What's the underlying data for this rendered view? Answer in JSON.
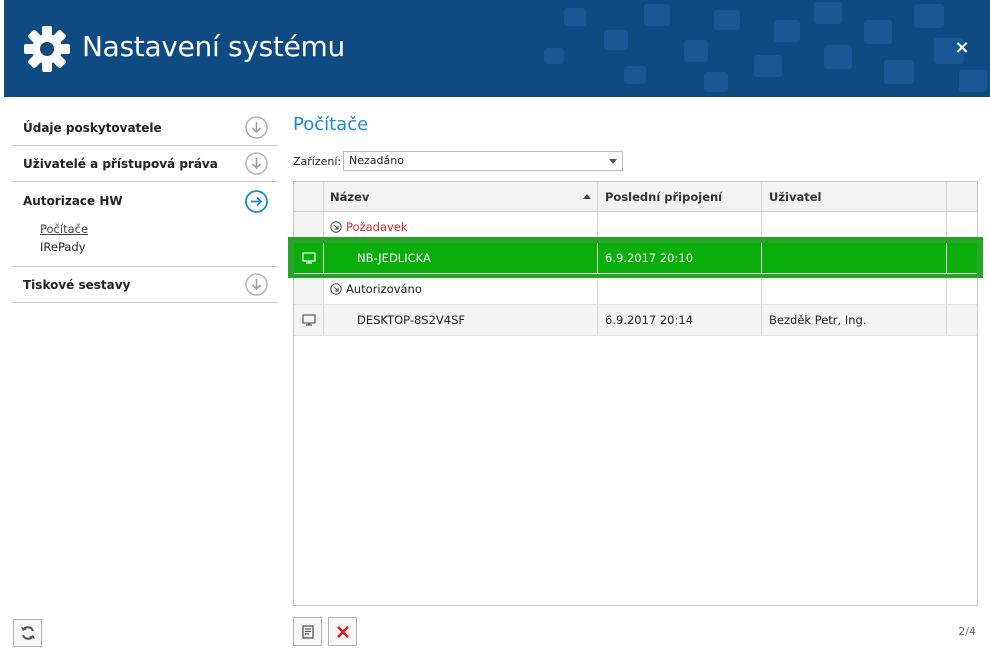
{
  "header": {
    "title": "Nastavení systému",
    "close_symbol": "×",
    "icon": "gear-icon",
    "bg_color": "#0e4b82"
  },
  "sidebar": {
    "items": [
      {
        "label": "Údaje poskytovatele",
        "icon": "arrow-down-circle-icon"
      },
      {
        "label": "Uživatelé a přístupová práva",
        "icon": "arrow-down-circle-icon"
      },
      {
        "label": "Autorizace HW",
        "icon": "arrow-right-circle-icon",
        "active": true,
        "subitems": [
          {
            "label": "Počítače",
            "active": true
          },
          {
            "label": "IRePady"
          }
        ]
      },
      {
        "label": "Tiskové sestavy",
        "icon": "arrow-down-circle-icon"
      }
    ],
    "refresh_icon": "refresh-icon"
  },
  "main": {
    "title": "Počítače",
    "device_label": "Zařízení:",
    "device_value": "Nezadáno",
    "columns": [
      "Název",
      "Poslední připojení",
      "Uživatel"
    ],
    "groups": [
      {
        "label": "Požadavek",
        "color": "#d22c2c",
        "rows": [
          {
            "name": "NB-JEDLICKA",
            "last": "6.9.2017 20:10",
            "user": "",
            "selected": true
          }
        ]
      },
      {
        "label": "Autorizováno",
        "rows": [
          {
            "name": "DESKTOP-8S2V4SF",
            "last": "6.9.2017 20:14",
            "user": "Bezděk Petr, Ing."
          }
        ]
      }
    ],
    "selected_color": "#0aae0a",
    "accent_color": "#1b8bd1",
    "pager": "2/4"
  }
}
